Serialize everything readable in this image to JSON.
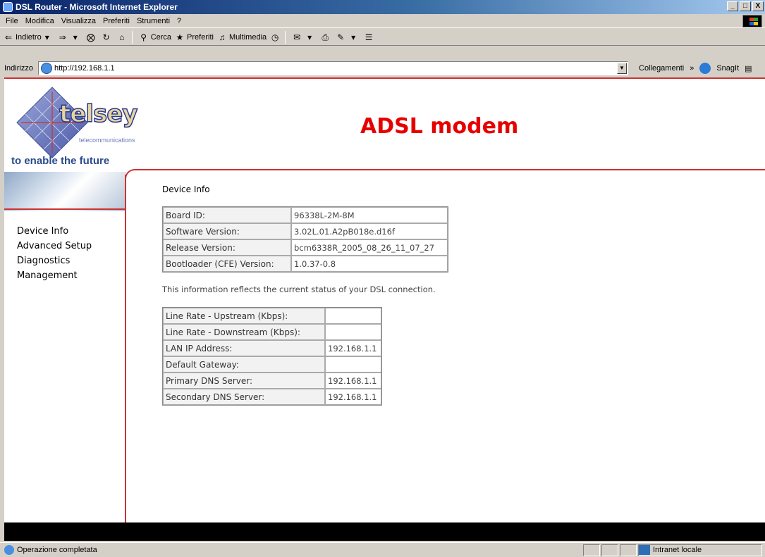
{
  "window": {
    "title": "DSL Router - Microsoft Internet Explorer",
    "controls": [
      "_",
      "̅",
      "X"
    ]
  },
  "menu": [
    "File",
    "Modifica",
    "Visualizza",
    "Preferiti",
    "Strumenti",
    "?"
  ],
  "toolbar": {
    "back": "Indietro",
    "search": "Cerca",
    "favorites": "Preferiti",
    "media": "Multimedia"
  },
  "address": {
    "label": "Indirizzo",
    "url": "http://192.168.1.1",
    "links": "Collegamenti",
    "snagit": "SnagIt"
  },
  "logo": {
    "name": "telsey",
    "sub": "telecommunications",
    "tagline": "to enable the future"
  },
  "page": {
    "title": "ADSL modem",
    "section_title": "Device Info",
    "description": "This information reflects the current status of your DSL connection."
  },
  "nav": [
    "Device Info",
    "Advanced Setup",
    "Diagnostics",
    "Management"
  ],
  "device_table": [
    {
      "key": "Board ID:",
      "value": "96338L-2M-8M"
    },
    {
      "key": "Software Version:",
      "value": "3.02L.01.A2pB018e.d16f"
    },
    {
      "key": "Release Version:",
      "value": "bcm6338R_2005_08_26_11_07_27"
    },
    {
      "key": "Bootloader (CFE) Version:",
      "value": "1.0.37-0.8"
    }
  ],
  "status_table": [
    {
      "key": "Line Rate - Upstream (Kbps):",
      "value": ""
    },
    {
      "key": "Line Rate - Downstream (Kbps):",
      "value": ""
    },
    {
      "key": "LAN IP Address:",
      "value": "192.168.1.1"
    },
    {
      "key": "Default Gateway:",
      "value": ""
    },
    {
      "key": "Primary DNS Server:",
      "value": "192.168.1.1"
    },
    {
      "key": "Secondary DNS Server:",
      "value": "192.168.1.1"
    }
  ],
  "statusbar": {
    "text": "Operazione completata",
    "zone": "Intranet locale"
  }
}
